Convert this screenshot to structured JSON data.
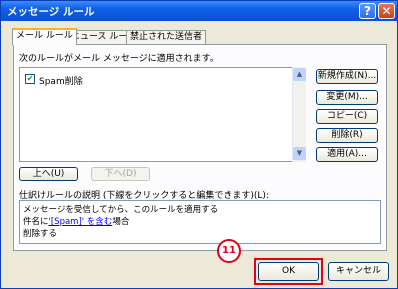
{
  "window": {
    "title": "メッセージ ルール",
    "help_glyph": "?",
    "close_glyph": "✕"
  },
  "tabs": [
    "メール ルール",
    "ニュース ルール",
    "禁止された送信者"
  ],
  "rules": {
    "heading": "次のルールがメール メッセージに適用されます。",
    "items": [
      {
        "label": "Spam削除",
        "checked": true
      }
    ],
    "scroll_up": "▲",
    "scroll_down": "▼"
  },
  "side_buttons": {
    "new": "新規作成(N)...",
    "change": "変更(M)...",
    "copy": "コピー(C)",
    "delete": "削除(R)",
    "apply": "適用(A)..."
  },
  "order_buttons": {
    "up": "上へ(U)",
    "down": "下へ(D)"
  },
  "description": {
    "label": "仕訳けルールの説明 (下線をクリックすると編集できます)(L):",
    "line1": "メッセージを受信してから、このルールを適用する",
    "line2_pre": "件名に",
    "line2_link": "'[Spam]' を含む",
    "line2_post": "場合",
    "line3": "削除する"
  },
  "footer": {
    "ok": "OK",
    "cancel": "キャンセル"
  },
  "annotation": {
    "step_marker": "11"
  }
}
